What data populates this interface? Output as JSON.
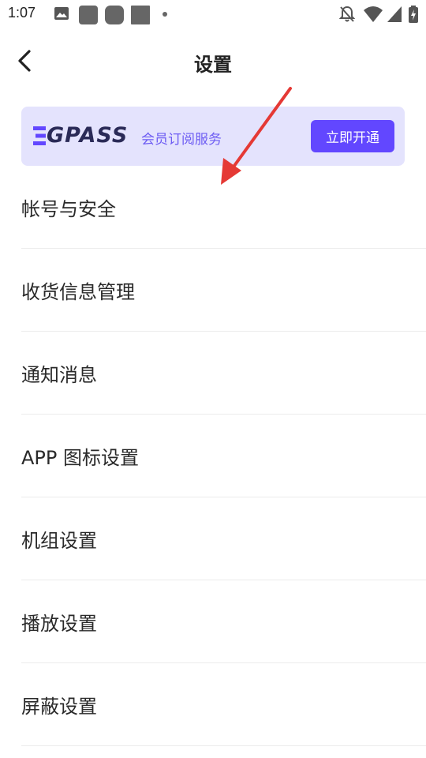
{
  "status_bar": {
    "time": "1:07"
  },
  "header": {
    "title": "设置"
  },
  "banner": {
    "logo_text": "GPASS",
    "subtitle": "会员订阅服务",
    "button_label": "立即开通",
    "bg_color": "#e4e3fd",
    "accent_color": "#6247ff"
  },
  "menu": {
    "items": [
      {
        "label": "帐号与安全"
      },
      {
        "label": "收货信息管理"
      },
      {
        "label": "通知消息"
      },
      {
        "label": "APP 图标设置"
      },
      {
        "label": "机组设置"
      },
      {
        "label": "播放设置"
      },
      {
        "label": "屏蔽设置"
      }
    ]
  },
  "annotation": {
    "color": "#e53935",
    "icon": "red-arrow-pointer"
  }
}
